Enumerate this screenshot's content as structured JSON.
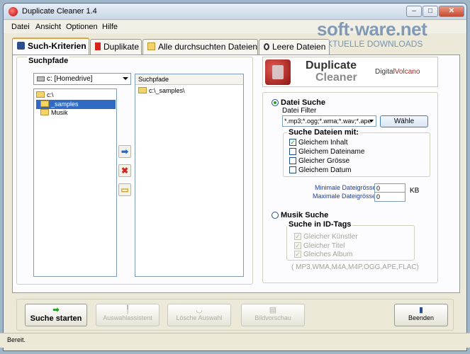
{
  "window": {
    "title": "Duplicate Cleaner 1.4"
  },
  "titlebar_buttons": {
    "minimize": "–",
    "maximize": "□",
    "close": "✕"
  },
  "watermark": {
    "title": "soft·ware.net",
    "subtitle": "AKTUELLE DOWNLOADS"
  },
  "menu": {
    "items": [
      "Datei",
      "Ansicht",
      "Optionen",
      "Hilfe"
    ]
  },
  "tabs": [
    {
      "label": "Such-Kriterien",
      "icon": "binoculars-icon",
      "active": true
    },
    {
      "label": "Duplikate",
      "icon": "red-flag-icon",
      "active": false
    },
    {
      "label": "Alle durchsuchten Dateien",
      "icon": "open-folder-icon",
      "active": false
    },
    {
      "label": "Leere Dateien",
      "icon": "empty-circle-icon",
      "active": false
    }
  ],
  "search_paths": {
    "group_label": "Suchpfade",
    "drive": "c: [Homedrive]",
    "tree": [
      {
        "label": "c:\\",
        "selected": false
      },
      {
        "label": "_samples",
        "selected": true
      },
      {
        "label": "Musik",
        "selected": false
      }
    ],
    "list_header": "Suchpfade",
    "list_items": [
      "c:\\_samples\\"
    ]
  },
  "logo": {
    "line1": "Duplicate",
    "line2": "Cleaner",
    "brand_a": "Digital",
    "brand_b": "Volcano"
  },
  "file_search": {
    "label": "Datei Suche",
    "selected": true,
    "filter_label": "Datei Filter",
    "filter_value": "*.mp3;*.ogg;*.wma;*.wav;*.ape",
    "choose_button": "Wähle",
    "match_group_label": "Suche Dateien mit:",
    "options": [
      {
        "label": "Gleichem Inhalt",
        "checked": true
      },
      {
        "label": "Gleichem Dateiname",
        "checked": false
      },
      {
        "label": "Gleicher Grösse",
        "checked": false
      },
      {
        "label": "Gleichem Datum",
        "checked": false
      }
    ],
    "min_size_label": "Minimale Dateigrösse",
    "max_size_label": "Maximale Dateigrösse",
    "min_size_value": "0",
    "max_size_value": "0",
    "size_unit": "KB"
  },
  "music_search": {
    "label": "Musik Suche",
    "selected": false,
    "group_label": "Suche in ID-Tags",
    "options": [
      {
        "label": "Gleicher Künstler",
        "checked": true
      },
      {
        "label": "Gleicher Titel",
        "checked": true
      },
      {
        "label": "Gleiches Album",
        "checked": true
      }
    ],
    "formats_note": "( MP3,WMA,M4A,M4P,OGG,APE,FLAC)"
  },
  "bottom_buttons": {
    "start": "Suche starten",
    "assistant": "Auswahlassistent",
    "delete": "Lösche Auswahl",
    "preview": "Bildvorschau",
    "exit": "Beenden"
  },
  "status": {
    "text": "Bereit."
  },
  "colors": {
    "accent": "#316ac5",
    "tab_highlight": "#e6a33b",
    "label_blue": "#1a3ea8"
  }
}
